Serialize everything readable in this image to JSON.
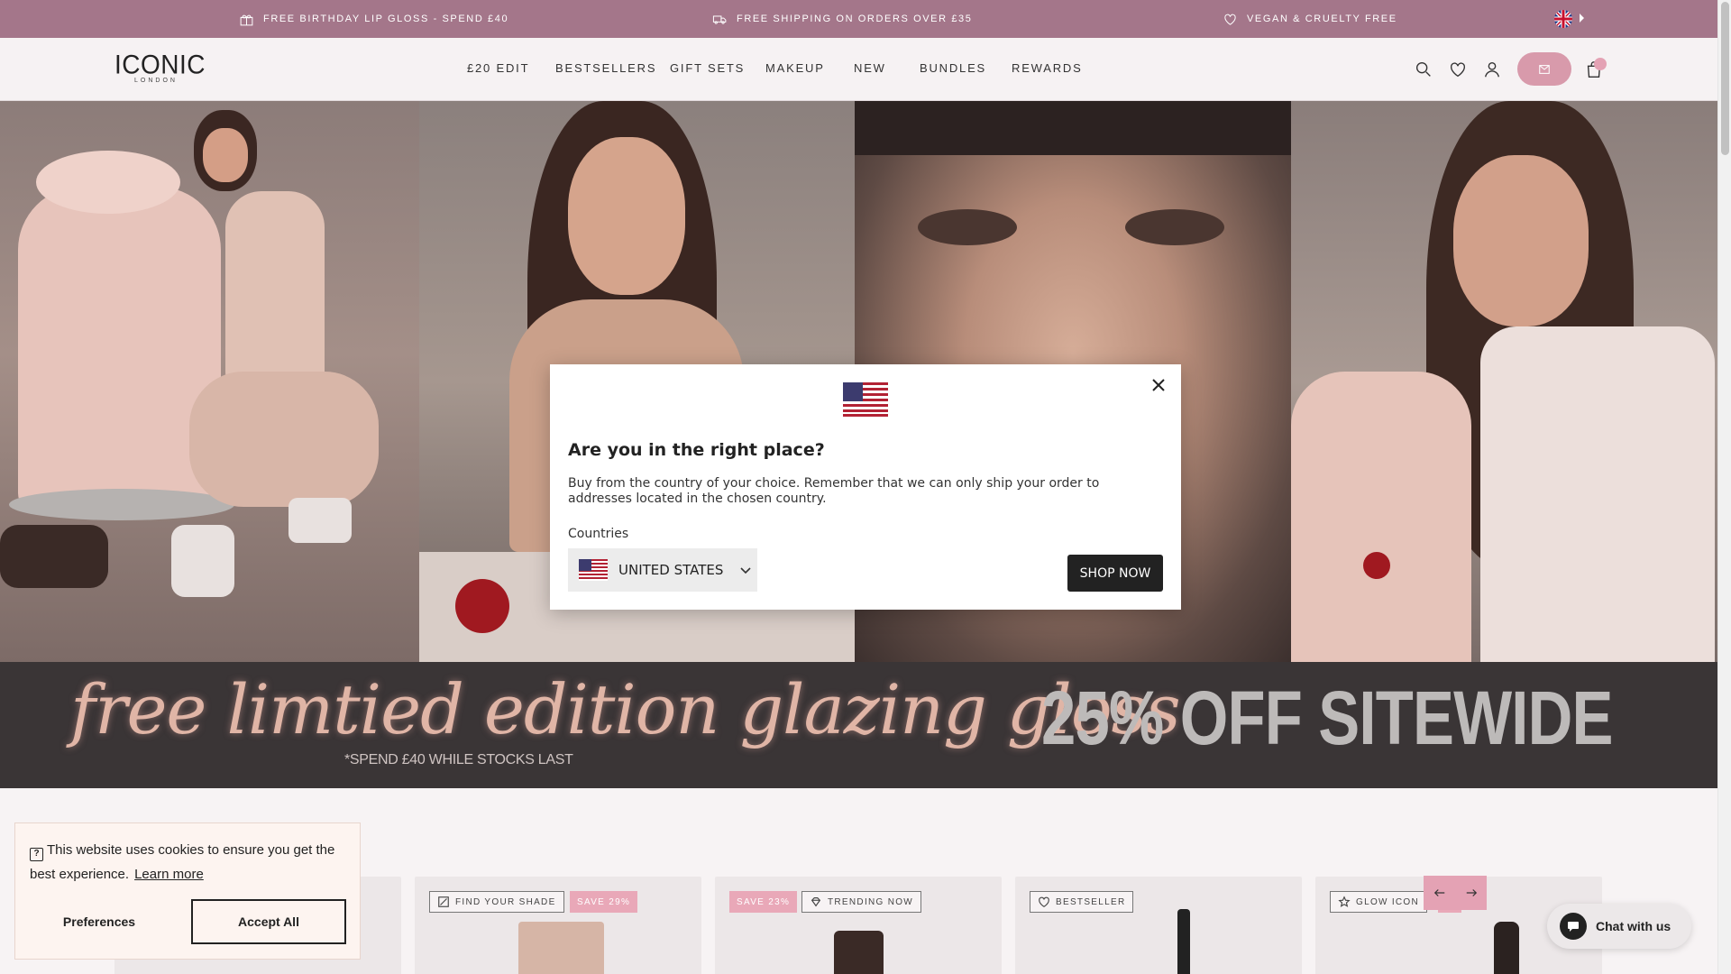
{
  "announcement": {
    "items": [
      {
        "icon": "gift-icon",
        "text": "FREE BIRTHDAY LIP GLOSS - SPEND £40"
      },
      {
        "icon": "truck-icon",
        "text": "FREE SHIPPING ON ORDERS OVER £35"
      },
      {
        "icon": "heart-icon",
        "text": "VEGAN & CRUELTY FREE"
      }
    ],
    "locale_icon": "uk-flag-icon"
  },
  "header": {
    "logo_main": "ICONIC",
    "logo_sub": "LONDON",
    "nav": [
      "£20 EDIT",
      "BESTSELLERS",
      "GIFT SETS",
      "MAKEUP",
      "NEW",
      "BUNDLES",
      "REWARDS"
    ],
    "icons": [
      "search-icon",
      "wishlist-heart-icon",
      "account-icon",
      "rewards-pill-icon",
      "bag-icon"
    ]
  },
  "promo": {
    "script_text": "free limtied edition glazing gloss",
    "note": "*SPEND £40 WHILE STOCKS LAST",
    "sale_text": "25% OFF SITEWIDE"
  },
  "products": {
    "tags": [
      {
        "label": "FIND YOUR SHADE",
        "icon": "swatch-icon",
        "style": "outline"
      },
      {
        "label": "SAVE 29%",
        "style": "pink"
      },
      {
        "label": "SAVE 23%",
        "style": "pink"
      },
      {
        "label": "TRENDING NOW",
        "icon": "diamond-icon",
        "style": "outline"
      },
      {
        "label": "BESTSELLER",
        "icon": "heart-icon",
        "style": "outline"
      },
      {
        "label": "GLOW ICON",
        "icon": "star-icon",
        "style": "outline"
      },
      {
        "label": "%",
        "style": "pink"
      }
    ]
  },
  "modal": {
    "flag_icon": "us-flag-icon",
    "title": "Are you in the right place?",
    "description": "Buy from the country of your choice. Remember that we can only ship your order to addresses located in the chosen country.",
    "countries_label": "Countries",
    "selected_country": "UNITED STATES",
    "shop_button": "SHOP NOW"
  },
  "cookie": {
    "text": "This website uses cookies to ensure you get the best experience.",
    "learn_more": "Learn more",
    "preferences": "Preferences",
    "accept": "Accept All"
  },
  "chat": {
    "label": "Chat with us"
  },
  "colors": {
    "announcement_bg": "#a4768a",
    "accent_pink": "#e4a2b4",
    "promo_bg": "#3a3536"
  }
}
